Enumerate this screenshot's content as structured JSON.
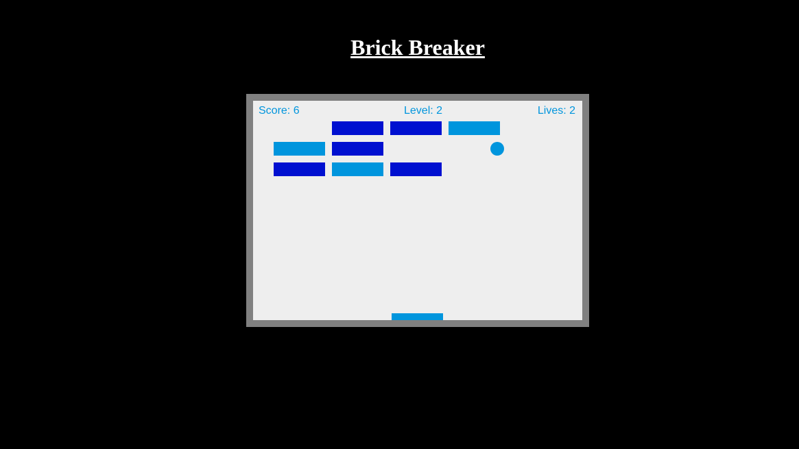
{
  "title": "Brick Breaker",
  "hud": {
    "score": "Score: 6",
    "level": "Level: 2",
    "lives": "Lives: 2"
  },
  "colors": {
    "page_background": "#000000",
    "frame": "#808080",
    "field": "#eeeeee",
    "accent": "#0095dd",
    "brick_dark": "#0010d0"
  },
  "bricks": [
    {
      "row": 0,
      "col": 0,
      "status": "broken"
    },
    {
      "row": 0,
      "col": 1,
      "status": "intact",
      "color": "#0010d0"
    },
    {
      "row": 0,
      "col": 2,
      "status": "intact",
      "color": "#0010d0"
    },
    {
      "row": 0,
      "col": 3,
      "status": "intact",
      "color": "#0095dd"
    },
    {
      "row": 1,
      "col": 0,
      "status": "intact",
      "color": "#0095dd"
    },
    {
      "row": 1,
      "col": 1,
      "status": "intact",
      "color": "#0010d0"
    },
    {
      "row": 1,
      "col": 2,
      "status": "broken"
    },
    {
      "row": 1,
      "col": 3,
      "status": "broken"
    },
    {
      "row": 2,
      "col": 0,
      "status": "intact",
      "color": "#0010d0"
    },
    {
      "row": 2,
      "col": 1,
      "status": "intact",
      "color": "#0095dd"
    },
    {
      "row": 2,
      "col": 2,
      "status": "intact",
      "color": "#0010d0"
    },
    {
      "row": 2,
      "col": 3,
      "status": "broken"
    }
  ]
}
